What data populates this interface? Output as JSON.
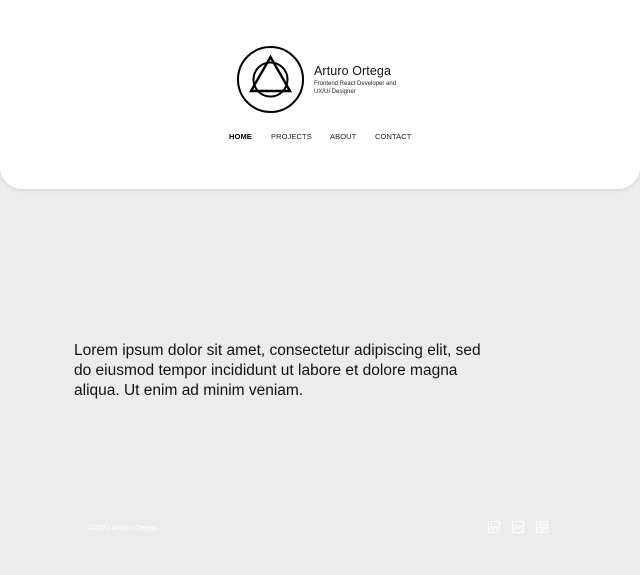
{
  "header": {
    "name": "Arturo Ortega",
    "tagline": "Frontend React Developer and UX/UI Designer",
    "nav": [
      {
        "label": "HOME",
        "active": true
      },
      {
        "label": "PROJECTS",
        "active": false
      },
      {
        "label": "ABOUT",
        "active": false
      },
      {
        "label": "CONTACT",
        "active": false
      }
    ]
  },
  "main": {
    "intro": "Lorem ipsum dolor sit amet, consectetur adipiscing elit, sed do eiusmod tempor incididunt ut labore et dolore magna aliqua. Ut enim ad minim veniam."
  },
  "footer": {
    "copyright": "©2022 Arturo Ortega",
    "social_icons": [
      "linkedin-icon",
      "behance-icon",
      "dribbble-icon"
    ]
  },
  "colors": {
    "background": "#ececec",
    "header_bg": "#ffffff",
    "text": "#111111",
    "footer_text": "#ffffff"
  }
}
